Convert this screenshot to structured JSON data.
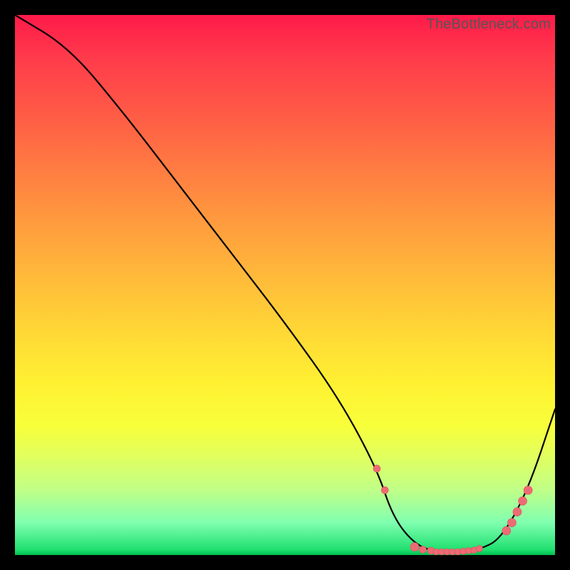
{
  "watermark": "TheBottleneck.com",
  "colors": {
    "background": "#000000",
    "curve": "#000000",
    "dot": "#ef6b74"
  },
  "chart_data": {
    "type": "line",
    "title": "",
    "xlabel": "",
    "ylabel": "",
    "xlim": [
      0,
      100
    ],
    "ylim": [
      0,
      100
    ],
    "series": [
      {
        "name": "bottleneck-curve",
        "x": [
          0,
          10,
          20,
          30,
          40,
          50,
          60,
          67,
          70,
          74,
          78,
          82,
          86,
          90,
          95,
          100
        ],
        "y": [
          100,
          94,
          82,
          69,
          56,
          43,
          29,
          16,
          7,
          2,
          0.5,
          0.5,
          1,
          3,
          12,
          27
        ]
      }
    ],
    "markers": {
      "name": "highlight-dots",
      "points": [
        {
          "x": 67.0,
          "y": 16.0,
          "r": 1.0
        },
        {
          "x": 68.5,
          "y": 12.0,
          "r": 1.0
        },
        {
          "x": 74.0,
          "y": 1.5,
          "r": 1.2
        },
        {
          "x": 75.5,
          "y": 1.0,
          "r": 1.0
        },
        {
          "x": 77.0,
          "y": 0.8,
          "r": 1.0
        },
        {
          "x": 78.0,
          "y": 0.6,
          "r": 0.9
        },
        {
          "x": 79.0,
          "y": 0.6,
          "r": 0.9
        },
        {
          "x": 80.0,
          "y": 0.6,
          "r": 0.9
        },
        {
          "x": 81.0,
          "y": 0.6,
          "r": 0.9
        },
        {
          "x": 82.0,
          "y": 0.6,
          "r": 0.9
        },
        {
          "x": 83.0,
          "y": 0.7,
          "r": 0.9
        },
        {
          "x": 84.0,
          "y": 0.8,
          "r": 0.9
        },
        {
          "x": 85.0,
          "y": 0.9,
          "r": 0.9
        },
        {
          "x": 86.0,
          "y": 1.2,
          "r": 0.9
        },
        {
          "x": 91.0,
          "y": 4.5,
          "r": 1.2
        },
        {
          "x": 92.0,
          "y": 6.0,
          "r": 1.2
        },
        {
          "x": 93.0,
          "y": 8.0,
          "r": 1.2
        },
        {
          "x": 94.0,
          "y": 10.0,
          "r": 1.2
        },
        {
          "x": 95.0,
          "y": 12.0,
          "r": 1.2
        }
      ]
    }
  }
}
